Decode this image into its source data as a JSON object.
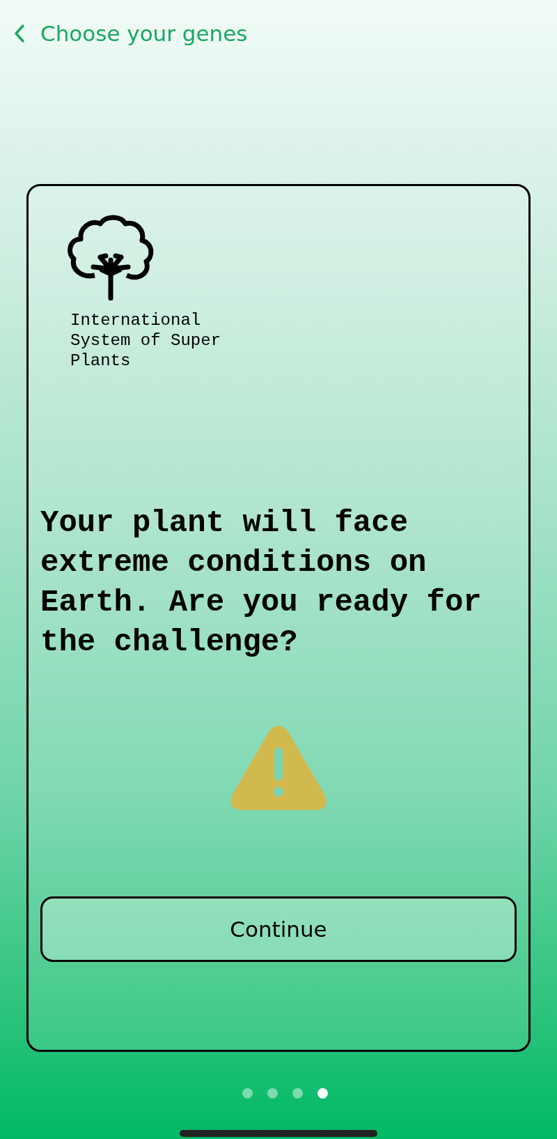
{
  "nav": {
    "back_title": "Choose your genes"
  },
  "card": {
    "org_name": "International\nSystem of Super\nPlants",
    "question": "Your plant will face extreme conditions on Earth. Are you ready for the challenge?",
    "button": "Continue"
  },
  "pager": [
    {
      "selected": false
    },
    {
      "selected": false
    },
    {
      "selected": false
    },
    {
      "selected": true
    }
  ]
}
